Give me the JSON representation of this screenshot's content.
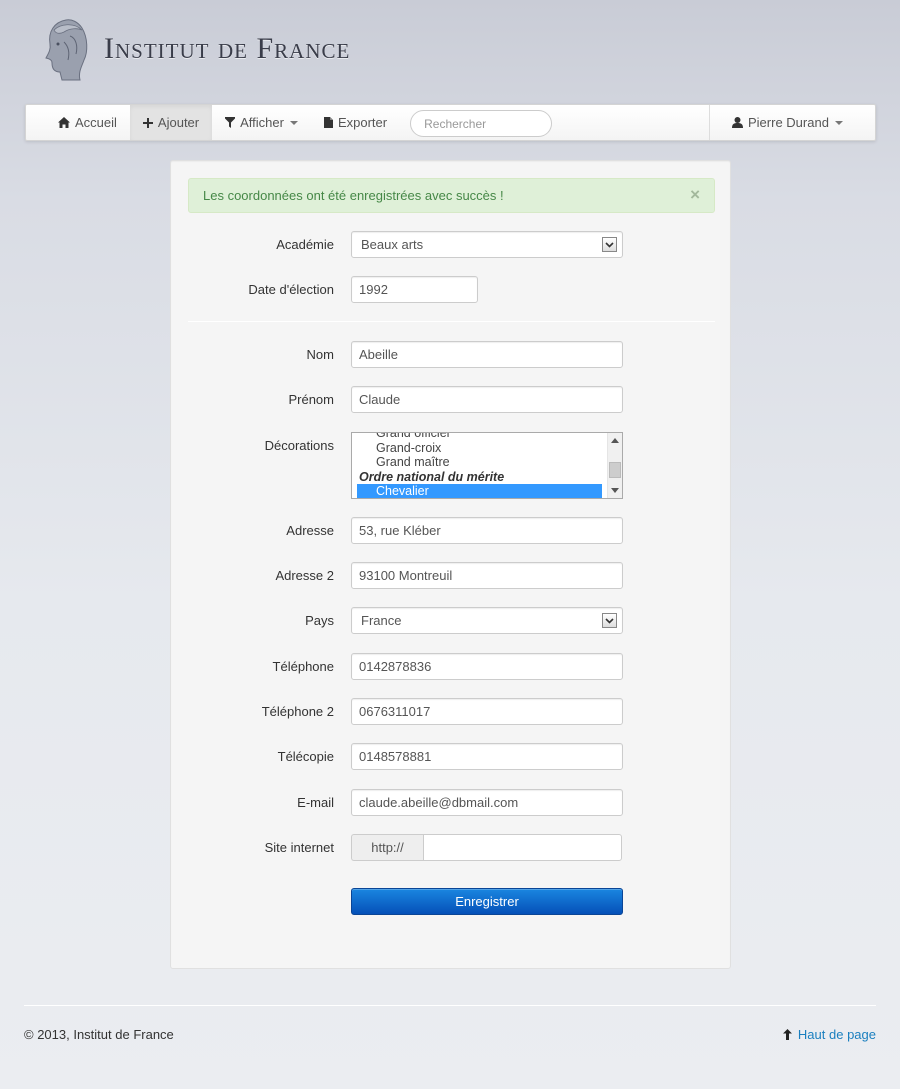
{
  "brand": {
    "name": "Institut de France",
    "logo_icon": "marianne-head-icon"
  },
  "navbar": {
    "items": [
      {
        "label": "Accueil",
        "icon": "home-icon"
      },
      {
        "label": "Ajouter",
        "icon": "plus-icon",
        "active": true
      },
      {
        "label": "Afficher",
        "icon": "filter-icon",
        "dropdown": true
      },
      {
        "label": "Exporter",
        "icon": "file-icon"
      }
    ],
    "search_placeholder": "Rechercher",
    "user": {
      "name": "Pierre Durand",
      "icon": "user-icon"
    }
  },
  "alert": {
    "message": "Les coordonnées ont été enregistrées avec succès !",
    "close": "×"
  },
  "form": {
    "academie": {
      "label": "Académie",
      "value": "Beaux arts"
    },
    "date_election": {
      "label": "Date d'élection",
      "value": "1992"
    },
    "nom": {
      "label": "Nom",
      "value": "Abeille"
    },
    "prenom": {
      "label": "Prénom",
      "value": "Claude"
    },
    "decorations": {
      "label": "Décorations",
      "options": [
        {
          "text": "Grand officier"
        },
        {
          "text": "Grand-croix"
        },
        {
          "text": "Grand maître"
        },
        {
          "text": "Ordre national du mérite",
          "group": true
        },
        {
          "text": "Chevalier",
          "selected": true
        }
      ]
    },
    "adresse": {
      "label": "Adresse",
      "value": "53, rue Kléber"
    },
    "adresse2": {
      "label": "Adresse 2",
      "value": "93100 Montreuil"
    },
    "pays": {
      "label": "Pays",
      "value": "France"
    },
    "telephone": {
      "label": "Téléphone",
      "value": "0142878836"
    },
    "telephone2": {
      "label": "Téléphone 2",
      "value": "0676311017"
    },
    "telecopie": {
      "label": "Télécopie",
      "value": "0148578881"
    },
    "email": {
      "label": "E-mail",
      "value": "claude.abeille@dbmail.com"
    },
    "site": {
      "label": "Site internet",
      "prefix": "http://",
      "value": ""
    },
    "submit_label": "Enregistrer"
  },
  "footer": {
    "copyright": "© 2013, Institut de France",
    "top_link": "Haut de page",
    "top_icon": "arrow-up-icon"
  },
  "colors": {
    "primary": "#0b62c4",
    "success_bg": "#dff0d8",
    "success_text": "#468847",
    "link": "#1a7fbf"
  }
}
